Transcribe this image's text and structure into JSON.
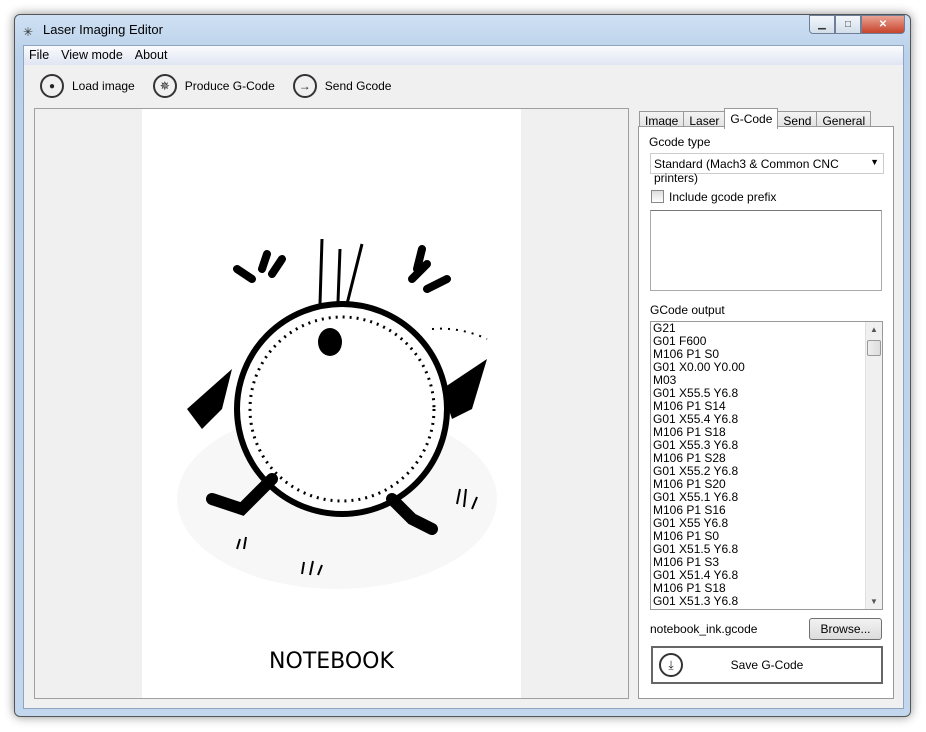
{
  "window": {
    "title": "Laser Imaging Editor",
    "icon": "laser-icon",
    "controls": {
      "minimize": "▁",
      "maximize": "□",
      "close": "✕"
    }
  },
  "menu": [
    "File",
    "View mode",
    "About"
  ],
  "toolbar": [
    {
      "label": "Load image",
      "icon": "camera-icon",
      "glyph": "📷"
    },
    {
      "label": "Produce G-Code",
      "icon": "laser-burst-icon",
      "glyph": "✵"
    },
    {
      "label": "Send Gcode",
      "icon": "arrow-right-icon",
      "glyph": "→"
    }
  ],
  "image": {
    "caption": "NOTEBOOK"
  },
  "tabs": [
    {
      "label": "Image",
      "active": false
    },
    {
      "label": "Laser",
      "active": false
    },
    {
      "label": "G-Code",
      "active": true
    },
    {
      "label": "Send",
      "active": false
    },
    {
      "label": "General",
      "active": false
    }
  ],
  "gcode": {
    "type_label": "Gcode type",
    "type_value": "Standard (Mach3 & Common CNC printers)",
    "prefix_label": "Include gcode prefix",
    "prefix_checked": false,
    "prefix_text": "",
    "output_label": "GCode output",
    "output_lines": [
      "G21",
      "G01 F600",
      "M106 P1 S0",
      "G01 X0.00 Y0.00",
      "M03",
      "G01 X55.5 Y6.8",
      "M106 P1 S14",
      "G01 X55.4 Y6.8",
      "M106 P1 S18",
      "G01 X55.3 Y6.8",
      "M106 P1 S28",
      "G01 X55.2 Y6.8",
      "M106 P1 S20",
      "G01 X55.1 Y6.8",
      "M106 P1 S16",
      "G01 X55 Y6.8",
      "M106 P1 S0",
      "G01 X51.5 Y6.8",
      "M106 P1 S3",
      "G01 X51.4 Y6.8",
      "M106 P1 S18",
      "G01 X51.3 Y6.8"
    ],
    "filename": "notebook_ink.gcode",
    "browse_label": "Browse...",
    "save_label": "Save G-Code"
  }
}
